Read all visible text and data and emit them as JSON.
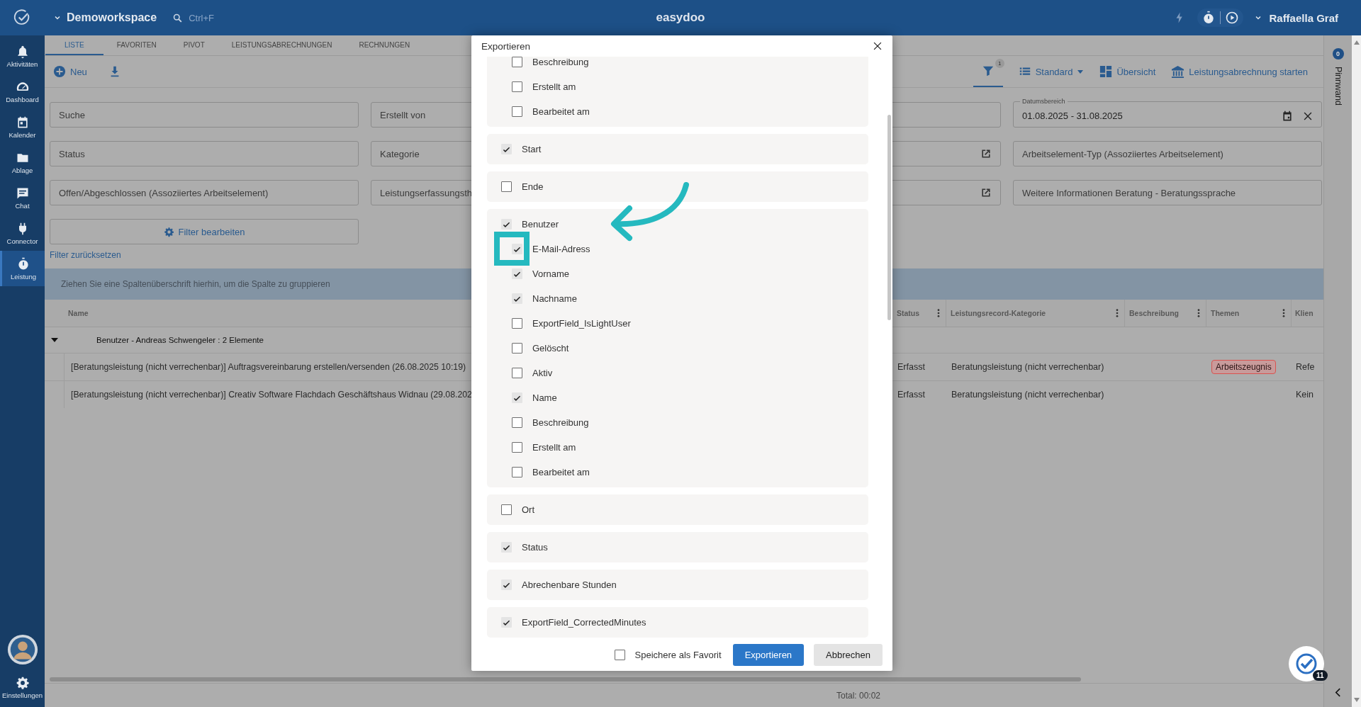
{
  "topbar": {
    "workspace": "Demoworkspace",
    "search_placeholder": "Ctrl+F",
    "title": "easydoo",
    "user": "Raffaella Graf"
  },
  "sidebar": {
    "items": [
      {
        "label": "Aktivitäten",
        "selected": false
      },
      {
        "label": "Dashboard",
        "selected": false
      },
      {
        "label": "Kalender",
        "selected": false
      },
      {
        "label": "Ablage",
        "selected": false
      },
      {
        "label": "Chat",
        "selected": false
      },
      {
        "label": "Connector",
        "selected": false
      },
      {
        "label": "Leistung",
        "selected": true
      }
    ],
    "settings": "Einstellungen"
  },
  "tabs": [
    {
      "label": "LISTE",
      "selected": true
    },
    {
      "label": "FAVORITEN",
      "selected": false
    },
    {
      "label": "PIVOT",
      "selected": false
    },
    {
      "label": "LEISTUNGSABRECHNUNGEN",
      "selected": false
    },
    {
      "label": "RECHNUNGEN",
      "selected": false
    }
  ],
  "toolbar": {
    "new": "Neu",
    "filter_count": "1",
    "view": "Standard",
    "overview": "Übersicht",
    "start_billing": "Leistungsabrechnung starten"
  },
  "filter_rows": [
    [
      {
        "kind": "text",
        "placeholder": "Suche"
      },
      {
        "kind": "text",
        "placeholder": "Erstellt von"
      },
      {
        "kind": "blank"
      },
      {
        "kind": "date",
        "label": "Datumsbereich",
        "value": "01.08.2025 - 31.08.2025"
      }
    ],
    [
      {
        "kind": "text",
        "placeholder": "Status"
      },
      {
        "kind": "text",
        "placeholder": "Kategorie"
      },
      {
        "kind": "link"
      },
      {
        "kind": "text",
        "placeholder": "Arbeitselement-Typ (Assoziiertes Arbeitselement)"
      }
    ],
    [
      {
        "kind": "text",
        "placeholder": "Offen/Abgeschlossen (Assoziiertes Arbeitselement)"
      },
      {
        "kind": "text",
        "placeholder": "Leistungserfassungsth"
      },
      {
        "kind": "link"
      },
      {
        "kind": "text",
        "placeholder": "Weitere Informationen Beratung - Beratungssprache"
      }
    ]
  ],
  "edit_filters": "Filter bearbeiten",
  "reset_filters": "Filter zurücksetzen",
  "group_hint": "Ziehen Sie eine Spaltenüberschrift hierhin, um die Spalte zu gruppieren",
  "table": {
    "columns": [
      "Name",
      "Status",
      "Leistungsrecord-Kategorie",
      "Beschreibung",
      "Themen",
      "Klien"
    ],
    "group": {
      "label": "Benutzer - Andreas Schwengeler : 2 Elemente",
      "expanded": true
    },
    "rows": [
      {
        "name": "[Beratungsleistung (nicht verrechenbar)] Auftragsvereinbarung erstellen/versenden (26.08.2025 10:19)",
        "status": "Erfasst",
        "category": "Beratungsleistung (nicht verrechenbar)",
        "topics": [
          {
            "label": "Arbeitszeugnis",
            "color": "#d9534f"
          }
        ],
        "column_6": "Refe"
      },
      {
        "name": "[Beratungsleistung (nicht verrechenbar)] Creativ Software Flachdach Geschäftshaus Widnau (29.08.202",
        "status": "Erfasst",
        "category": "Beratungsleistung (nicht verrechenbar)",
        "topics": [],
        "column_6": "Kein"
      }
    ]
  },
  "total": "Total: 00:02",
  "pinboard": {
    "label": "Pinnwand",
    "count": "0"
  },
  "help_badge": "11",
  "dialog": {
    "title": "Exportieren",
    "groups": [
      {
        "children": [
          {
            "label": "Beschreibung",
            "checked": false
          },
          {
            "label": "Erstellt am",
            "checked": false
          },
          {
            "label": "Bearbeitet am",
            "checked": false
          }
        ]
      },
      {
        "label": "Start",
        "checked": true
      },
      {
        "label": "Ende",
        "checked": false
      },
      {
        "label": "Benutzer",
        "checked": true,
        "children": [
          {
            "label": "E-Mail-Adress",
            "checked": true
          },
          {
            "label": "Vorname",
            "checked": true
          },
          {
            "label": "Nachname",
            "checked": true
          },
          {
            "label": "ExportField_IsLightUser",
            "checked": false
          },
          {
            "label": "Gelöscht",
            "checked": false
          },
          {
            "label": "Aktiv",
            "checked": false
          },
          {
            "label": "Name",
            "checked": true
          },
          {
            "label": "Beschreibung",
            "checked": false
          },
          {
            "label": "Erstellt am",
            "checked": false
          },
          {
            "label": "Bearbeitet am",
            "checked": false
          }
        ]
      },
      {
        "label": "Ort",
        "checked": false
      },
      {
        "label": "Status",
        "checked": true
      },
      {
        "label": "Abrechenbare Stunden",
        "checked": true
      },
      {
        "label": "ExportField_CorrectedMinutes",
        "checked": true
      }
    ],
    "favorite": {
      "label": "Speichere als Favorit",
      "checked": false
    },
    "buttons": [
      {
        "label": "Exportieren",
        "kind": "primary"
      },
      {
        "label": "Abbrechen",
        "kind": "secondary"
      }
    ]
  }
}
